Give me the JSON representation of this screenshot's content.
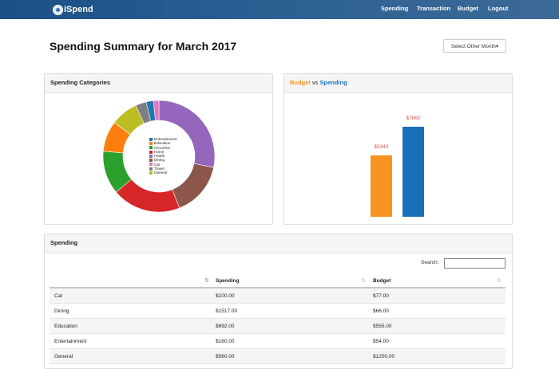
{
  "nav": {
    "brand": "iSpend",
    "links": [
      "Spending",
      "Transaction",
      "Budget",
      "Logout"
    ]
  },
  "page_title": "Spending Summary for March 2017",
  "month_button": "Select Other Month▾",
  "categories_panel": {
    "title": "Spending Categories",
    "legend": [
      {
        "name": "Entertainment",
        "color": "#1f77b4"
      },
      {
        "name": "Education",
        "color": "#ff7f0e"
      },
      {
        "name": "Groceries",
        "color": "#2ca02c"
      },
      {
        "name": "Home",
        "color": "#d62728"
      },
      {
        "name": "Health",
        "color": "#9467bd"
      },
      {
        "name": "Dining",
        "color": "#8c564b"
      },
      {
        "name": "Car",
        "color": "#e377c2"
      },
      {
        "name": "Travel",
        "color": "#7f7f7f"
      },
      {
        "name": "General",
        "color": "#bcbd22"
      }
    ]
  },
  "budget_panel": {
    "title_budget": "Budget",
    "title_vs": " vs ",
    "title_spending": "Spending"
  },
  "chart_data": [
    {
      "type": "pie",
      "title": "Spending Categories",
      "donut": true,
      "slices": [
        {
          "name": "Health",
          "value": 27,
          "color": "#9467bd"
        },
        {
          "name": "Dining",
          "value": 15,
          "color": "#8c564b"
        },
        {
          "name": "Home",
          "value": 19,
          "color": "#d62728"
        },
        {
          "name": "Groceries",
          "value": 12,
          "color": "#2ca02c"
        },
        {
          "name": "Education",
          "value": 8.5,
          "color": "#ff7f0e"
        },
        {
          "name": "General",
          "value": 7.5,
          "color": "#bcbd22"
        },
        {
          "name": "Travel",
          "value": 3,
          "color": "#7f7f7f"
        },
        {
          "name": "Entertainment",
          "value": 2,
          "color": "#1f77b4"
        },
        {
          "name": "Car",
          "value": 1.5,
          "color": "#e377c2"
        }
      ]
    },
    {
      "type": "bar",
      "categories": [
        "Budget",
        "Spending"
      ],
      "values": [
        5343,
        7860
      ],
      "value_labels": [
        "$5343",
        "$7860"
      ],
      "colors": [
        "#f7931e",
        "#1a70b8"
      ],
      "ylim": [
        0,
        8800
      ]
    }
  ],
  "spending_panel": {
    "title": "Spending",
    "search_label": "Search:",
    "columns": [
      "",
      "Spending",
      "Budget"
    ],
    "rows": [
      [
        "Car",
        "$100.00",
        "$77.00"
      ],
      [
        "Dining",
        "$1517.00",
        "$66.00"
      ],
      [
        "Education",
        "$692.00",
        "$555.00"
      ],
      [
        "Entertainment",
        "$160.00",
        "$54.00"
      ],
      [
        "General",
        "$560.00",
        "$1200.00"
      ]
    ]
  }
}
